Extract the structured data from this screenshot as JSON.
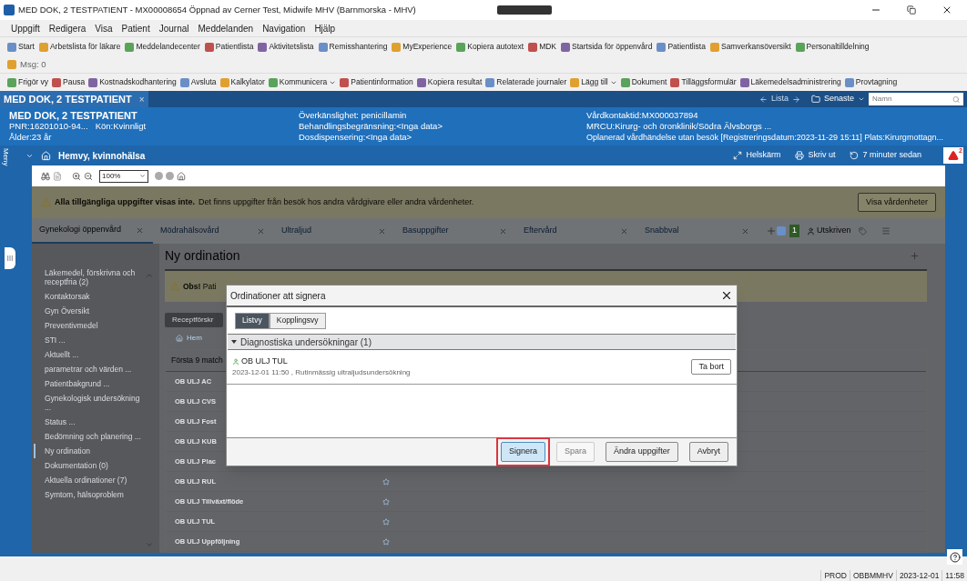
{
  "window": {
    "title": "MED DOK, 2 TESTPATIENT - MX00008654 Öppnad av Cerner Test, Midwife MHV (Barnmorska - MHV)"
  },
  "menu": [
    "Uppgift",
    "Redigera",
    "Visa",
    "Patient",
    "Journal",
    "Meddelanden",
    "Navigation",
    "Hjälp"
  ],
  "toolbar_1": [
    "Start",
    "Arbetslista för läkare",
    "Meddelandecenter",
    "Patientlista",
    "Aktivitetslista",
    "Remisshantering",
    "MyExperience",
    "Kopiera autotext",
    "MDK",
    "Startsida för öppenvård",
    "Patientlista",
    "Samverkansöversikt",
    "Personaltilldelning"
  ],
  "message_count": "Msg: 0",
  "toolbar_2": [
    {
      "label": "Frigör vy",
      "dropdown": false
    },
    {
      "label": "Pausa",
      "dropdown": false
    },
    {
      "label": "Kostnadskodhantering",
      "dropdown": false
    },
    {
      "label": "Avsluta",
      "dropdown": false
    },
    {
      "label": "Kalkylator",
      "dropdown": false
    },
    {
      "label": "Kommunicera",
      "dropdown": true
    },
    {
      "label": "Patientinformation",
      "dropdown": false
    },
    {
      "label": "Kopiera resultat",
      "dropdown": false
    },
    {
      "label": "Relaterade journaler",
      "dropdown": false
    },
    {
      "label": "Lägg till",
      "dropdown": true
    },
    {
      "label": "Dokument",
      "dropdown": false
    },
    {
      "label": "Tilläggsformulär",
      "dropdown": false
    },
    {
      "label": "Läkemedelsadministrering",
      "dropdown": false
    },
    {
      "label": "Provtagning",
      "dropdown": false
    }
  ],
  "patient_tab": {
    "label": "MED DOK, 2 TESTPATIENT",
    "close": "×"
  },
  "patient_nav": {
    "list": "Lista",
    "recent": "Senaste",
    "search_placeholder": "Namn"
  },
  "patient": {
    "name": "MED DOK, 2 TESTPATIENT",
    "pnr": "PNR:16201010-94...",
    "sex": "Kön:Kvinnligt",
    "age": "Ålder:23 år",
    "allergy": "Överkänslighet: penicillamin",
    "treatment_limit": "Behandlingsbegränsning:<Inga data>",
    "dosing": "Dosdispensering:<Inga data>",
    "contact": "Vårdkontaktid:MX000037894",
    "unit": "MRCU:Kirurg- och öronklinik/Södra Älvsborgs ...",
    "planned": "Oplanerad vårdhändelse utan besök [Registreringsdatum:2023-11-29 15:11] Plats:Kirurgmottagn..."
  },
  "side_label": "Meny",
  "nav": {
    "title": "Hemvy, kvinnohälsa",
    "actions": [
      "Helskärm",
      "Skriv ut",
      "7 minuter sedan"
    ],
    "alerts": "2"
  },
  "zoom": "100%",
  "warning": {
    "bold": "Alla tillgängliga uppgifter visas inte.",
    "text": "Det finns uppgifter från besök hos andra vårdgivare eller andra vårdenheter.",
    "button": "Visa vårdenheter"
  },
  "tabs": [
    {
      "label": "Gynekologi öppenvård",
      "selected": true
    },
    {
      "label": "Mödrahälsovård",
      "selected": false
    },
    {
      "label": "Ultraljud",
      "selected": false
    },
    {
      "label": "Basuppgifter",
      "selected": false
    },
    {
      "label": "Eftervård",
      "selected": false
    },
    {
      "label": "Snabbval",
      "selected": false
    }
  ],
  "tab_badge": "1",
  "discharged": "Utskriven",
  "sidebar": [
    {
      "label": "Läkemedel, förskrivna och receptfria (2)",
      "selected": false
    },
    {
      "label": "Kontaktorsak",
      "selected": false
    },
    {
      "label": "Gyn Översikt",
      "selected": false
    },
    {
      "label": "Preventivmedel",
      "selected": false
    },
    {
      "label": "STI ...",
      "selected": false
    },
    {
      "label": "Aktuellt ...",
      "selected": false
    },
    {
      "label": "parametrar och värden ...",
      "selected": false
    },
    {
      "label": "Patientbakgrund ...",
      "selected": false
    },
    {
      "label": "Gynekologisk undersökning ...",
      "selected": false
    },
    {
      "label": "Status ...",
      "selected": false
    },
    {
      "label": "Bedömning och planering ...",
      "selected": false
    },
    {
      "label": "Ny ordination",
      "selected": true
    },
    {
      "label": "Dokumentation (0)",
      "selected": false
    },
    {
      "label": "Aktuella ordinationer (7)",
      "selected": false
    },
    {
      "label": "Symtom, hälsoproblem",
      "selected": false
    }
  ],
  "heading": "Ny ordination",
  "notice": {
    "bold": "Obs!",
    "text": "Pati"
  },
  "prescription_button": "Receptförskr",
  "home_link": "Hem",
  "table": {
    "header": "Första 9 match",
    "rows": [
      "OB ULJ AC",
      "OB ULJ CVS",
      "OB ULJ Fost",
      "OB ULJ KUB",
      "OB ULJ Plac",
      "OB ULJ RUL",
      "OB ULJ Tillväxt/flöde",
      "OB ULJ TUL",
      "OB ULJ Uppföljning"
    ]
  },
  "dialog": {
    "title": "Ordinationer att signera",
    "views": [
      {
        "label": "Listvy",
        "selected": true
      },
      {
        "label": "Kopplingsvy",
        "selected": false
      }
    ],
    "group": {
      "label": "Diagnostiska undersökningar (1)",
      "expanded": true
    },
    "items": [
      {
        "name": "OB ULJ TUL",
        "detail": "2023-12-01 11:50 , Rutinmässig ultraljudsundersökning",
        "remove": "Ta bort"
      }
    ],
    "buttons": [
      {
        "label": "Signera",
        "kind": "primary",
        "highlighted": true
      },
      {
        "label": "Spara",
        "kind": "disabled",
        "highlighted": false
      },
      {
        "label": "Ändra uppgifter",
        "kind": "normal",
        "highlighted": false
      },
      {
        "label": "Avbryt",
        "kind": "normal",
        "highlighted": false
      }
    ]
  },
  "status_bar": [
    "PROD",
    "OBBMMHV",
    "2023-12-01",
    "11:58"
  ]
}
